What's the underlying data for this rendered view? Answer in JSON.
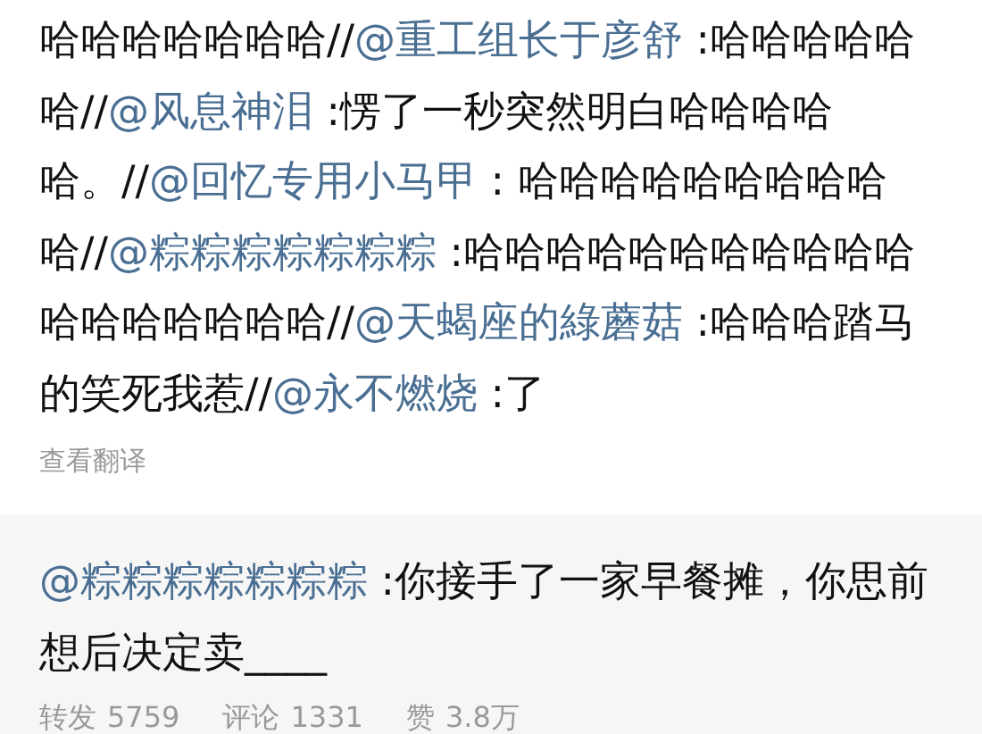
{
  "post": {
    "segments": [
      {
        "kind": "text",
        "text": "哈哈哈哈哈哈哈//"
      },
      {
        "kind": "mention",
        "text": "@重工组长于彦舒"
      },
      {
        "kind": "text",
        "text": " :哈哈哈哈哈哈//"
      },
      {
        "kind": "mention",
        "text": "@风息神泪"
      },
      {
        "kind": "text",
        "text": " :愣了一秒突然明白哈哈哈哈哈。//"
      },
      {
        "kind": "mention",
        "text": "@回忆专用小马甲"
      },
      {
        "kind": "text",
        "text": " : 哈哈哈哈哈哈哈哈哈哈//"
      },
      {
        "kind": "mention",
        "text": "@粽粽粽粽粽粽粽"
      },
      {
        "kind": "text",
        "text": " :哈哈哈哈哈哈哈哈哈哈哈哈哈哈哈哈哈哈//"
      },
      {
        "kind": "mention",
        "text": "@天蝎座的綠蘑菇"
      },
      {
        "kind": "text",
        "text": " :哈哈哈踏马的笑死我惹//"
      },
      {
        "kind": "mention",
        "text": "@永不燃烧"
      },
      {
        "kind": "text",
        "text": " :了"
      }
    ],
    "translate_link": "查看翻译"
  },
  "quoted": {
    "segments": [
      {
        "kind": "mention",
        "text": "@粽粽粽粽粽粽粽"
      },
      {
        "kind": "text",
        "text": " :你接手了一家早餐摊，你思前想后决定卖____"
      }
    ],
    "stats": [
      {
        "label": "转发",
        "count": "5759"
      },
      {
        "label": "评论",
        "count": "1331"
      },
      {
        "label": "赞",
        "count": "3.8万"
      }
    ]
  }
}
